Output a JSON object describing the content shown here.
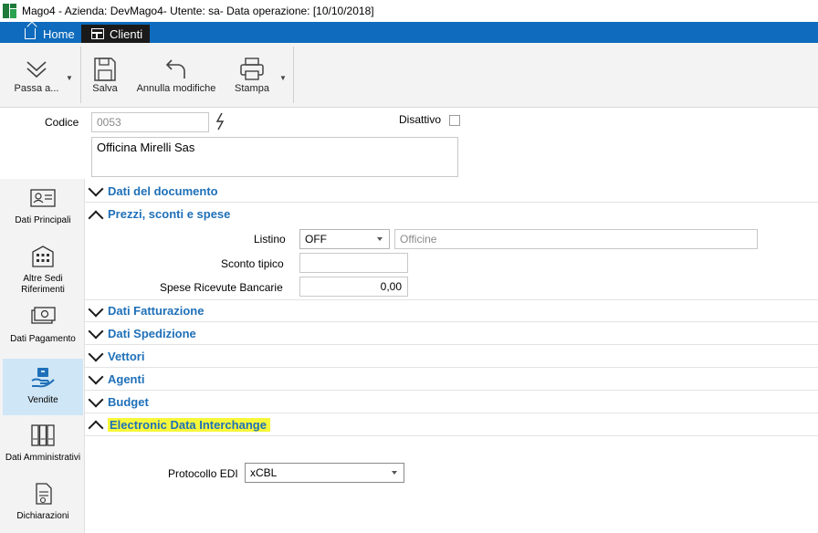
{
  "window": {
    "title": "Mago4 - Azienda: DevMago4- Utente: sa- Data operazione: [10/10/2018]"
  },
  "tabs": [
    {
      "label": "Home",
      "icon": "home-icon"
    },
    {
      "label": "Clienti",
      "icon": "form-icon"
    }
  ],
  "toolbar": {
    "passa_label": "Passa a...",
    "salva_label": "Salva",
    "annulla_label": "Annulla modifiche",
    "stampa_label": "Stampa"
  },
  "header": {
    "codice_label": "Codice",
    "codice_value": "0053",
    "disattivo_label": "Disattivo",
    "ragione_sociale": "Officina Mirelli Sas"
  },
  "sidebar": {
    "items": [
      {
        "label": "Dati Principali",
        "icon": "id-card-icon"
      },
      {
        "label": "Altre Sedi Riferimenti",
        "icon": "building-icon"
      },
      {
        "label": "Dati Pagamento",
        "icon": "money-icon"
      },
      {
        "label": "Vendite",
        "icon": "hand-box-icon"
      },
      {
        "label": "Dati Amministrativi",
        "icon": "binders-icon"
      },
      {
        "label": "Dichiarazioni",
        "icon": "document-icon"
      }
    ]
  },
  "sections": {
    "dati_documento": "Dati del documento",
    "prezzi": "Prezzi, sconti e spese",
    "dati_fatturazione": "Dati Fatturazione",
    "dati_spedizione": "Dati Spedizione",
    "vettori": "Vettori",
    "agenti": "Agenti",
    "budget": "Budget",
    "edi": "Electronic Data Interchange"
  },
  "prezzi": {
    "listino_label": "Listino",
    "listino_value": "OFF",
    "listino_desc": "Officine",
    "sconto_label": "Sconto tipico",
    "sconto_value": "",
    "spese_label": "Spese Ricevute Bancarie",
    "spese_value": "0,00"
  },
  "edi": {
    "protocollo_label": "Protocollo EDI",
    "protocollo_value": "xCBL"
  },
  "colors": {
    "accent": "#0e6bbd",
    "section_title": "#1f70b8",
    "highlight": "#f7f73a",
    "active_sidebar": "#cfe6f6"
  }
}
